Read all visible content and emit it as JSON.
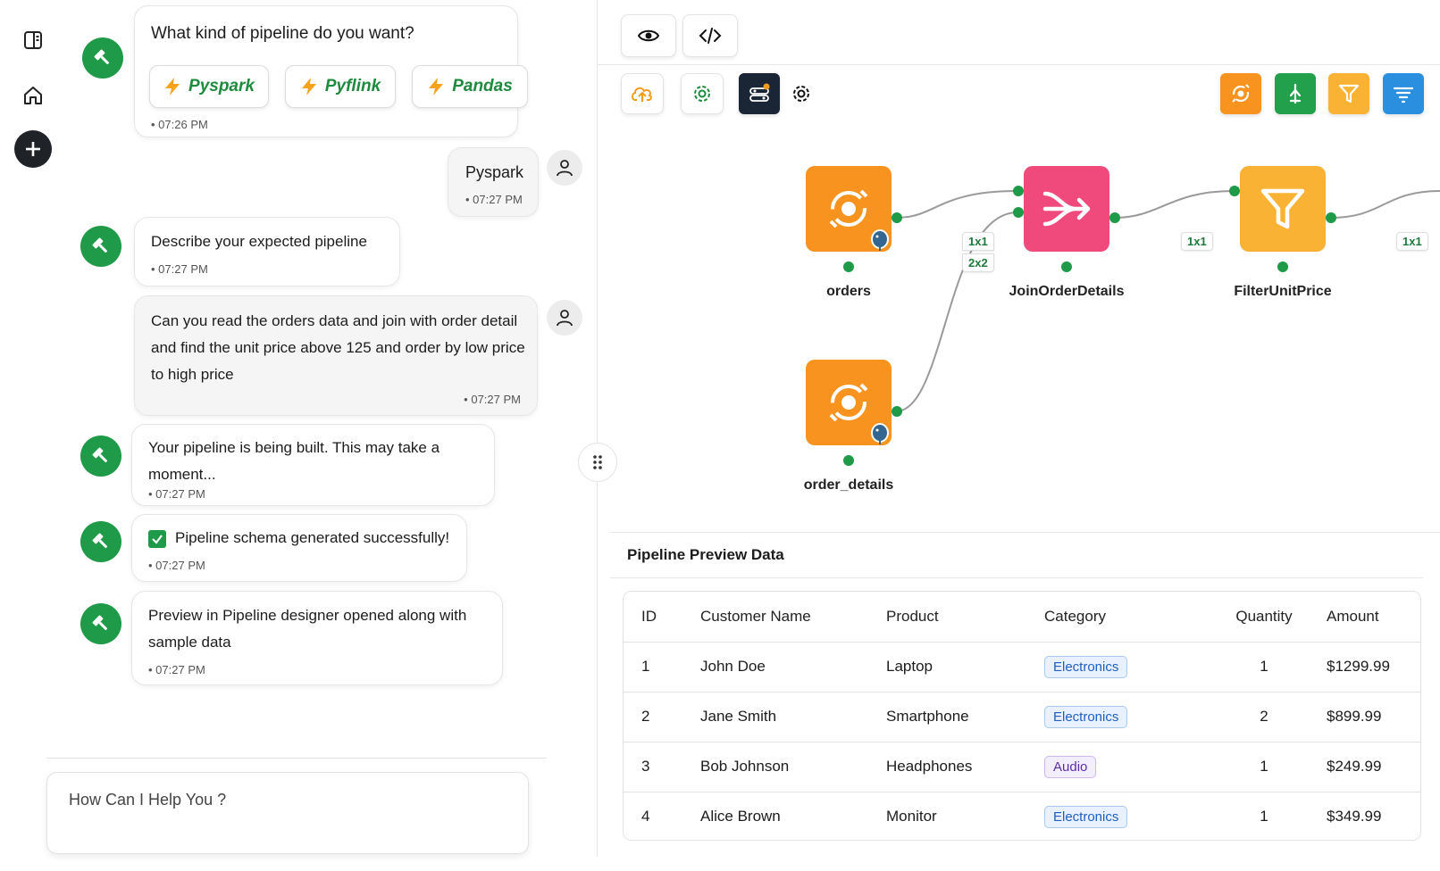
{
  "chat": {
    "options_prompt": "What kind of pipeline do you want?",
    "options": [
      "Pyspark",
      "Pyflink",
      "Pandas"
    ],
    "options_time": "07:26 PM",
    "messages": [
      {
        "role": "user",
        "text": "Pyspark",
        "time": "07:27 PM"
      },
      {
        "role": "bot",
        "text": "Describe your expected pipeline",
        "time": "07:27 PM"
      },
      {
        "role": "user",
        "text": "Can you read the orders data and join with order detail and find the unit price above 125 and order by low price to high price",
        "time": "07:27 PM"
      },
      {
        "role": "bot",
        "text": "Your pipeline is being built. This may take a moment...",
        "time": "07:27 PM"
      },
      {
        "role": "bot",
        "text": "Pipeline schema generated successfully!",
        "time": "07:27 PM"
      },
      {
        "role": "bot",
        "text": "Preview in Pipeline designer opened along with sample data",
        "time": "07:27 PM"
      }
    ],
    "input_placeholder": "How Can I Help You ?"
  },
  "rail": {
    "icons": [
      "sidebar-toggle-icon",
      "home-icon",
      "plus-icon"
    ]
  },
  "toolbar": {
    "view_icons": [
      "eye-icon",
      "code-icon"
    ],
    "action_icons": [
      "cloud-upload-icon",
      "gear-icon",
      "toggle-settings-icon",
      "gear-icon"
    ],
    "palette": [
      {
        "icon": "source-icon",
        "color": "#f7931e"
      },
      {
        "icon": "join-icon",
        "color": "#22a04b"
      },
      {
        "icon": "filter-icon",
        "color": "#f9b233"
      },
      {
        "icon": "sort-icon",
        "color": "#2b8fe0"
      }
    ]
  },
  "pipeline": {
    "nodes": [
      {
        "id": "orders",
        "label": "orders",
        "type": "source",
        "color": "#f7931e"
      },
      {
        "id": "order_details",
        "label": "order_details",
        "type": "source",
        "color": "#f7931e"
      },
      {
        "id": "join",
        "label": "JoinOrderDetails",
        "type": "join",
        "color": "#f04a7c"
      },
      {
        "id": "filter",
        "label": "FilterUnitPrice",
        "type": "filter",
        "color": "#f9b233"
      }
    ],
    "edge_tags": [
      "1x1",
      "2x2",
      "1x1",
      "1x1"
    ]
  },
  "preview": {
    "title": "Pipeline Preview Data",
    "columns": [
      "ID",
      "Customer Name",
      "Product",
      "Category",
      "Quantity",
      "Amount"
    ],
    "rows": [
      {
        "id": "1",
        "name": "John Doe",
        "product": "Laptop",
        "category": "Electronics",
        "qty": "1",
        "amount": "$1299.99"
      },
      {
        "id": "2",
        "name": "Jane Smith",
        "product": "Smartphone",
        "category": "Electronics",
        "qty": "2",
        "amount": "$899.99"
      },
      {
        "id": "3",
        "name": "Bob Johnson",
        "product": "Headphones",
        "category": "Audio",
        "qty": "1",
        "amount": "$249.99"
      },
      {
        "id": "4",
        "name": "Alice Brown",
        "product": "Monitor",
        "category": "Electronics",
        "qty": "1",
        "amount": "$349.99"
      }
    ],
    "category_colors": {
      "Electronics": {
        "bg": "#e8f1fd",
        "border": "#a9c9f3",
        "text": "#1f5fbf"
      },
      "Audio": {
        "bg": "#f3eefc",
        "border": "#cbb8ef",
        "text": "#5a2ea6"
      }
    }
  }
}
